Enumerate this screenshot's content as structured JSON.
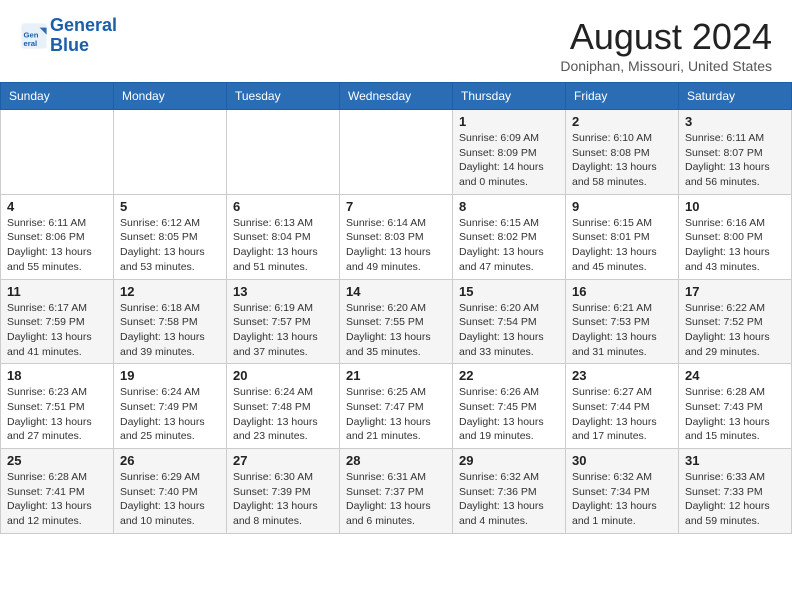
{
  "header": {
    "logo_line1": "General",
    "logo_line2": "Blue",
    "month_title": "August 2024",
    "location": "Doniphan, Missouri, United States"
  },
  "weekdays": [
    "Sunday",
    "Monday",
    "Tuesday",
    "Wednesday",
    "Thursday",
    "Friday",
    "Saturday"
  ],
  "weeks": [
    [
      {
        "day": "",
        "detail": ""
      },
      {
        "day": "",
        "detail": ""
      },
      {
        "day": "",
        "detail": ""
      },
      {
        "day": "",
        "detail": ""
      },
      {
        "day": "1",
        "detail": "Sunrise: 6:09 AM\nSunset: 8:09 PM\nDaylight: 14 hours\nand 0 minutes."
      },
      {
        "day": "2",
        "detail": "Sunrise: 6:10 AM\nSunset: 8:08 PM\nDaylight: 13 hours\nand 58 minutes."
      },
      {
        "day": "3",
        "detail": "Sunrise: 6:11 AM\nSunset: 8:07 PM\nDaylight: 13 hours\nand 56 minutes."
      }
    ],
    [
      {
        "day": "4",
        "detail": "Sunrise: 6:11 AM\nSunset: 8:06 PM\nDaylight: 13 hours\nand 55 minutes."
      },
      {
        "day": "5",
        "detail": "Sunrise: 6:12 AM\nSunset: 8:05 PM\nDaylight: 13 hours\nand 53 minutes."
      },
      {
        "day": "6",
        "detail": "Sunrise: 6:13 AM\nSunset: 8:04 PM\nDaylight: 13 hours\nand 51 minutes."
      },
      {
        "day": "7",
        "detail": "Sunrise: 6:14 AM\nSunset: 8:03 PM\nDaylight: 13 hours\nand 49 minutes."
      },
      {
        "day": "8",
        "detail": "Sunrise: 6:15 AM\nSunset: 8:02 PM\nDaylight: 13 hours\nand 47 minutes."
      },
      {
        "day": "9",
        "detail": "Sunrise: 6:15 AM\nSunset: 8:01 PM\nDaylight: 13 hours\nand 45 minutes."
      },
      {
        "day": "10",
        "detail": "Sunrise: 6:16 AM\nSunset: 8:00 PM\nDaylight: 13 hours\nand 43 minutes."
      }
    ],
    [
      {
        "day": "11",
        "detail": "Sunrise: 6:17 AM\nSunset: 7:59 PM\nDaylight: 13 hours\nand 41 minutes."
      },
      {
        "day": "12",
        "detail": "Sunrise: 6:18 AM\nSunset: 7:58 PM\nDaylight: 13 hours\nand 39 minutes."
      },
      {
        "day": "13",
        "detail": "Sunrise: 6:19 AM\nSunset: 7:57 PM\nDaylight: 13 hours\nand 37 minutes."
      },
      {
        "day": "14",
        "detail": "Sunrise: 6:20 AM\nSunset: 7:55 PM\nDaylight: 13 hours\nand 35 minutes."
      },
      {
        "day": "15",
        "detail": "Sunrise: 6:20 AM\nSunset: 7:54 PM\nDaylight: 13 hours\nand 33 minutes."
      },
      {
        "day": "16",
        "detail": "Sunrise: 6:21 AM\nSunset: 7:53 PM\nDaylight: 13 hours\nand 31 minutes."
      },
      {
        "day": "17",
        "detail": "Sunrise: 6:22 AM\nSunset: 7:52 PM\nDaylight: 13 hours\nand 29 minutes."
      }
    ],
    [
      {
        "day": "18",
        "detail": "Sunrise: 6:23 AM\nSunset: 7:51 PM\nDaylight: 13 hours\nand 27 minutes."
      },
      {
        "day": "19",
        "detail": "Sunrise: 6:24 AM\nSunset: 7:49 PM\nDaylight: 13 hours\nand 25 minutes."
      },
      {
        "day": "20",
        "detail": "Sunrise: 6:24 AM\nSunset: 7:48 PM\nDaylight: 13 hours\nand 23 minutes."
      },
      {
        "day": "21",
        "detail": "Sunrise: 6:25 AM\nSunset: 7:47 PM\nDaylight: 13 hours\nand 21 minutes."
      },
      {
        "day": "22",
        "detail": "Sunrise: 6:26 AM\nSunset: 7:45 PM\nDaylight: 13 hours\nand 19 minutes."
      },
      {
        "day": "23",
        "detail": "Sunrise: 6:27 AM\nSunset: 7:44 PM\nDaylight: 13 hours\nand 17 minutes."
      },
      {
        "day": "24",
        "detail": "Sunrise: 6:28 AM\nSunset: 7:43 PM\nDaylight: 13 hours\nand 15 minutes."
      }
    ],
    [
      {
        "day": "25",
        "detail": "Sunrise: 6:28 AM\nSunset: 7:41 PM\nDaylight: 13 hours\nand 12 minutes."
      },
      {
        "day": "26",
        "detail": "Sunrise: 6:29 AM\nSunset: 7:40 PM\nDaylight: 13 hours\nand 10 minutes."
      },
      {
        "day": "27",
        "detail": "Sunrise: 6:30 AM\nSunset: 7:39 PM\nDaylight: 13 hours\nand 8 minutes."
      },
      {
        "day": "28",
        "detail": "Sunrise: 6:31 AM\nSunset: 7:37 PM\nDaylight: 13 hours\nand 6 minutes."
      },
      {
        "day": "29",
        "detail": "Sunrise: 6:32 AM\nSunset: 7:36 PM\nDaylight: 13 hours\nand 4 minutes."
      },
      {
        "day": "30",
        "detail": "Sunrise: 6:32 AM\nSunset: 7:34 PM\nDaylight: 13 hours\nand 1 minute."
      },
      {
        "day": "31",
        "detail": "Sunrise: 6:33 AM\nSunset: 7:33 PM\nDaylight: 12 hours\nand 59 minutes."
      }
    ]
  ]
}
